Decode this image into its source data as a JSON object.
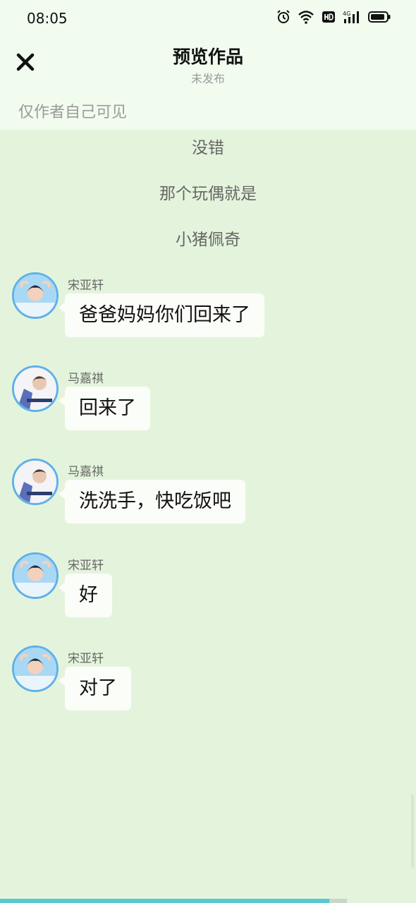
{
  "status_bar": {
    "time": "08:05",
    "icons": [
      "alarm-icon",
      "wifi-icon",
      "hd-icon",
      "signal-4g-icon",
      "battery-icon"
    ]
  },
  "header": {
    "title": "预览作品",
    "subtitle": "未发布",
    "close_icon": "close-icon",
    "visibility_note": "仅作者自己可见"
  },
  "narration": [
    "没错",
    "那个玩偶就是",
    "小猪佩奇"
  ],
  "messages": [
    {
      "sender": "宋亚轩",
      "text": "爸爸妈妈你们回来了"
    },
    {
      "sender": "马嘉祺",
      "text": "回来了"
    },
    {
      "sender": "马嘉祺",
      "text": "洗洗手，快吃饭吧"
    },
    {
      "sender": "宋亚轩",
      "text": "好"
    },
    {
      "sender": "宋亚轩",
      "text": "对了"
    }
  ],
  "reading_progress": 0.95,
  "colors": {
    "background": "#e4f4dc",
    "header_background": "#f1fcef",
    "avatar_border": "#5fb1ea",
    "bubble": "#fbfdf9",
    "progress": "#55c8d2"
  }
}
